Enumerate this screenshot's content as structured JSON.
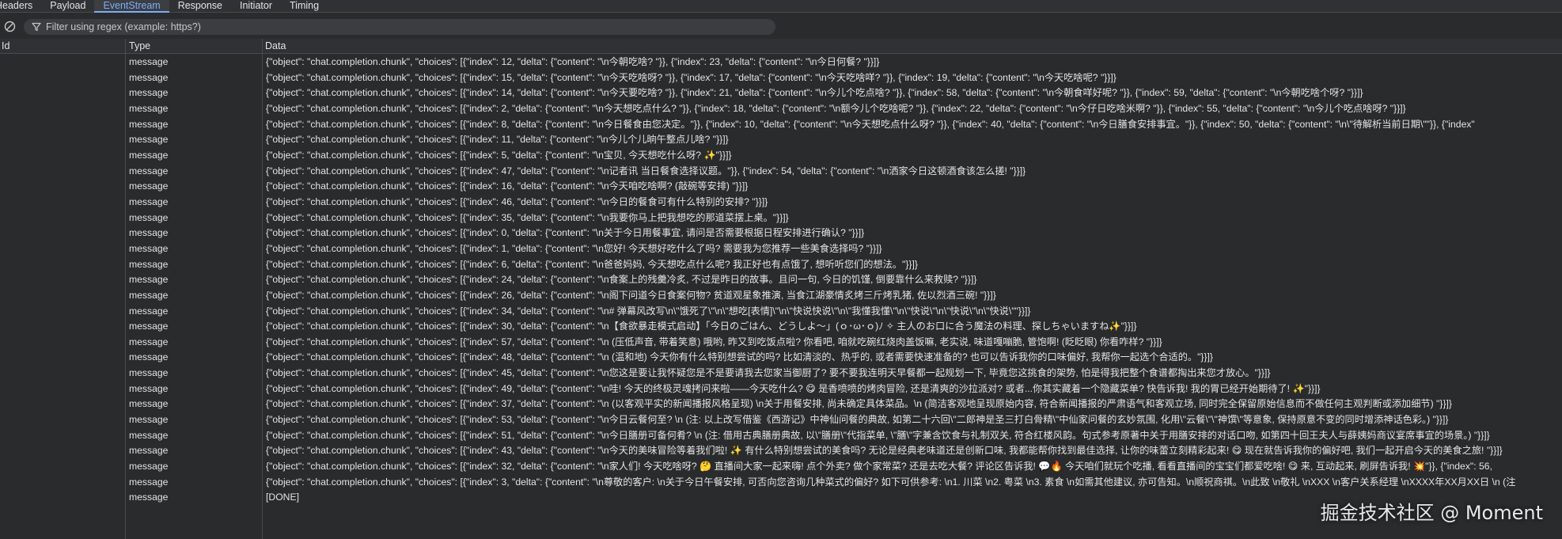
{
  "tabs": [
    {
      "label": "Headers",
      "active": false
    },
    {
      "label": "Payload",
      "active": false
    },
    {
      "label": "EventStream",
      "active": true
    },
    {
      "label": "Response",
      "active": false
    },
    {
      "label": "Initiator",
      "active": false
    },
    {
      "label": "Timing",
      "active": false
    }
  ],
  "filter": {
    "placeholder": "Filter using regex (example: https?)",
    "value": ""
  },
  "columns": {
    "id": "Id",
    "type": "Type",
    "data": "Data"
  },
  "icons": {
    "clear": "clear-icon",
    "filter": "filter-funnel-icon"
  },
  "colors": {
    "accent": "#7cacf8",
    "background": "#2a2b2d",
    "header": "#303134"
  },
  "rows": [
    {
      "id": "",
      "type": "message",
      "data": "{\"object\": \"chat.completion.chunk\", \"choices\": [{\"index\": 12, \"delta\": {\"content\": \"\\n今朝吃啥? \"}}, {\"index\": 23, \"delta\": {\"content\": \"\\n今日何餐? \"}}]}"
    },
    {
      "id": "",
      "type": "message",
      "data": "{\"object\": \"chat.completion.chunk\", \"choices\": [{\"index\": 15, \"delta\": {\"content\": \"\\n今天吃啥呀? \"}}, {\"index\": 17, \"delta\": {\"content\": \"\\n今天吃啥咩? \"}}, {\"index\": 19, \"delta\": {\"content\": \"\\n今天吃啥呢? \"}}]}"
    },
    {
      "id": "",
      "type": "message",
      "data": "{\"object\": \"chat.completion.chunk\", \"choices\": [{\"index\": 14, \"delta\": {\"content\": \"\\n今天要吃啥? \"}}, {\"index\": 21, \"delta\": {\"content\": \"\\n今儿个吃点啥? \"}}, {\"index\": 58, \"delta\": {\"content\": \"\\n今朝食咩好呢? \"}}, {\"index\": 59, \"delta\": {\"content\": \"\\n今朝吃啥个呀? \"}}]}"
    },
    {
      "id": "",
      "type": "message",
      "data": "{\"object\": \"chat.completion.chunk\", \"choices\": [{\"index\": 2, \"delta\": {\"content\": \"\\n今天想吃点什么? \"}}, {\"index\": 18, \"delta\": {\"content\": \"\\n额今儿个吃啥呢? \"}}, {\"index\": 22, \"delta\": {\"content\": \"\\n今仔日吃啥米啊? \"}}, {\"index\": 55, \"delta\": {\"content\": \"\\n今儿个吃点啥呀? \"}}]}"
    },
    {
      "id": "",
      "type": "message",
      "data": "{\"object\": \"chat.completion.chunk\", \"choices\": [{\"index\": 8, \"delta\": {\"content\": \"\\n今日餐食由您决定。\"}}, {\"index\": 10, \"delta\": {\"content\": \"\\n今天想吃点什么呀? \"}}, {\"index\": 40, \"delta\": {\"content\": \"\\n今日膳食安排事宜。\"}}, {\"index\": 50, \"delta\": {\"content\": \"\\n\\\"待解析当前日期\\\"\"}}, {\"index\""
    },
    {
      "id": "",
      "type": "message",
      "data": "{\"object\": \"chat.completion.chunk\", \"choices\": [{\"index\": 11, \"delta\": {\"content\": \"\\n今儿个儿晌午整点儿啥? \"}}]}"
    },
    {
      "id": "",
      "type": "message",
      "data": "{\"object\": \"chat.completion.chunk\", \"choices\": [{\"index\": 5, \"delta\": {\"content\": \"\\n宝贝, 今天想吃什么呀? ✨\"}}]}"
    },
    {
      "id": "",
      "type": "message",
      "data": "{\"object\": \"chat.completion.chunk\", \"choices\": [{\"index\": 47, \"delta\": {\"content\": \"\\n记者讯 当日餐食选择议题。\"}}, {\"index\": 54, \"delta\": {\"content\": \"\\n洒家今日这顿酒食该怎么搓! \"}}]}"
    },
    {
      "id": "",
      "type": "message",
      "data": "{\"object\": \"chat.completion.chunk\", \"choices\": [{\"index\": 16, \"delta\": {\"content\": \"\\n今天咱吃啥啊? (敲碗等安排) \"}}]}"
    },
    {
      "id": "",
      "type": "message",
      "data": "{\"object\": \"chat.completion.chunk\", \"choices\": [{\"index\": 46, \"delta\": {\"content\": \"\\n今日的餐食可有什么特别的安排? \"}}]}"
    },
    {
      "id": "",
      "type": "message",
      "data": "{\"object\": \"chat.completion.chunk\", \"choices\": [{\"index\": 35, \"delta\": {\"content\": \"\\n我要你马上把我想吃的那道菜摆上桌。\"}}]}"
    },
    {
      "id": "",
      "type": "message",
      "data": "{\"object\": \"chat.completion.chunk\", \"choices\": [{\"index\": 0, \"delta\": {\"content\": \"\\n关于今日用餐事宜, 请问是否需要根据日程安排进行确认? \"}}]}"
    },
    {
      "id": "",
      "type": "message",
      "data": "{\"object\": \"chat.completion.chunk\", \"choices\": [{\"index\": 1, \"delta\": {\"content\": \"\\n您好! 今天想好吃什么了吗? 需要我为您推荐一些美食选择吗? \"}}]}"
    },
    {
      "id": "",
      "type": "message",
      "data": "{\"object\": \"chat.completion.chunk\", \"choices\": [{\"index\": 6, \"delta\": {\"content\": \"\\n爸爸妈妈, 今天想吃点什么呢? 我正好也有点饿了, 想听听您们的想法。\"}}]}"
    },
    {
      "id": "",
      "type": "message",
      "data": "{\"object\": \"chat.completion.chunk\", \"choices\": [{\"index\": 24, \"delta\": {\"content\": \"\\n食案上的残羹冷炙, 不过是昨日的故事。且问一句, 今日的饥馑, 倒要靠什么来救赎? \"}}]}"
    },
    {
      "id": "",
      "type": "message",
      "data": "{\"object\": \"chat.completion.chunk\", \"choices\": [{\"index\": 26, \"delta\": {\"content\": \"\\n阁下问道今日食案何物? 贫道观星象推演, 当食江湖豪情炙烤三斤烤乳猪, 佐以烈酒三碗! \"}}]}"
    },
    {
      "id": "",
      "type": "message",
      "data": "{\"object\": \"chat.completion.chunk\", \"choices\": [{\"index\": 34, \"delta\": {\"content\": \"\\n# 弹幕风改写\\n\\\"饿死了\\\"\\n\\\"想吃[表情]\\\"\\n\\\"快说快说\\\"\\n\\\"我懂我懂\\\"\\n\\\"快说\\\"\\n\\\"快说\\\"\\n\\\"快说\\\"\"}}]}"
    },
    {
      "id": "",
      "type": "message",
      "data": "{\"object\": \"chat.completion.chunk\", \"choices\": [{\"index\": 30, \"delta\": {\"content\": \"\\n【食欲暴走模式启动】「今日のごはん、どうしよ〜」(ｏ･ω･ｏ)ﾉ ✧ 主人のお口に合う魔法の料理、探しちゃいますね✨\"}}]}"
    },
    {
      "id": "",
      "type": "message",
      "data": "{\"object\": \"chat.completion.chunk\", \"choices\": [{\"index\": 57, \"delta\": {\"content\": \"\\n (压低声音, 带着笑意) 哦哟, 昨又到吃饭点啦? 你看吧, 咱就吃碗红烧肉盖饭嘛, 老实说, 味道嘎嘣脆, 管饱啊! (眨眨眼) 你看咋样? \"}}]}"
    },
    {
      "id": "",
      "type": "message",
      "data": "{\"object\": \"chat.completion.chunk\", \"choices\": [{\"index\": 48, \"delta\": {\"content\": \"\\n (温和地) 今天你有什么特别想尝试的吗? 比如清淡的、热乎的, 或者需要快速准备的? 也可以告诉我你的口味偏好, 我帮你一起选个合适的。\"}}]}"
    },
    {
      "id": "",
      "type": "message",
      "data": "{\"object\": \"chat.completion.chunk\", \"choices\": [{\"index\": 45, \"delta\": {\"content\": \"\\n您这是要让我怀疑您是不是要请我去您家当御厨了? 要不要我连明天早餐都一起规划一下, 毕竟您这挑食的架势, 怕是得我把整个食谱都掏出来您才放心。\"}}]}"
    },
    {
      "id": "",
      "type": "message",
      "data": "{\"object\": \"chat.completion.chunk\", \"choices\": [{\"index\": 49, \"delta\": {\"content\": \"\\n哇! 今天的终极灵魂拷问来啦——今天吃什么? 😋 是香喷喷的烤肉冒险, 还是清爽的沙拉派对? 或者...你其实藏着一个隐藏菜单? 快告诉我! 我的胃已经开始期待了! ✨\"}}]}"
    },
    {
      "id": "",
      "type": "message",
      "data": "{\"object\": \"chat.completion.chunk\", \"choices\": [{\"index\": 37, \"delta\": {\"content\": \"\\n (以客观平实的新闻播报风格呈现) \\n关于用餐安排, 尚未确定具体菜品。\\n (简洁客观地呈现原始内容, 符合新闻播报的严肃语气和客观立场, 同时完全保留原始信息而不做任何主观判断或添加细节) \"}}]}"
    },
    {
      "id": "",
      "type": "message",
      "data": "{\"object\": \"chat.completion.chunk\", \"choices\": [{\"index\": 53, \"delta\": {\"content\": \"\\n今日云餐何至? \\n (注: 以上改写借鉴《西游记》中神仙问餐的典故, 如第二十六回\\\"二郎神是圣三打白骨精\\\"中仙家问餐的玄妙氛围, 化用\\\"云餐\\\"\\\"神馔\\\"等意象, 保持原意不变的同时增添神话色彩。) \"}}]}"
    },
    {
      "id": "",
      "type": "message",
      "data": "{\"object\": \"chat.completion.chunk\", \"choices\": [{\"index\": 51, \"delta\": {\"content\": \"\\n今日膳册可备何肴? \\n (注: 借用古典膳册典故, 以\\\"膳册\\\"代指菜单, \\\"膳\\\"字兼含饮食与礼制双关, 符合红楼风韵。句式参考原著中关于用膳安排的对话口吻, 如第四十回王夫人与薛姨妈商议宴席事宜的场景。) \"}}]}"
    },
    {
      "id": "",
      "type": "message",
      "data": "{\"object\": \"chat.completion.chunk\", \"choices\": [{\"index\": 43, \"delta\": {\"content\": \"\\n今天的美味冒险等着我们啦! ✨ 有什么特别想尝试的美食吗? 无论是经典老味道还是创新口味, 我都能帮你找到最佳选择, 让你的味蕾立刻精彩起来! 😋 现在就告诉我你的偏好吧, 我们一起开启今天的美食之旅! \"}}]}"
    },
    {
      "id": "",
      "type": "message",
      "data": "{\"object\": \"chat.completion.chunk\", \"choices\": [{\"index\": 32, \"delta\": {\"content\": \"\\n家人们! 今天吃啥呀? 🤔 直播间大家一起来嗨! 点个外卖? 做个家常菜? 还是去吃大餐? 评论区告诉我! 💬🔥 今天咱们就玩个吃播, 看看直播间的宝宝们都爱吃啥! 😋 来, 互动起来, 刷屏告诉我! 💥\"}}, {\"index\": 56,"
    },
    {
      "id": "",
      "type": "message",
      "data": "{\"object\": \"chat.completion.chunk\", \"choices\": [{\"index\": 3, \"delta\": {\"content\": \"\\n尊敬的客户: \\n关于今日午餐安排, 可否向您咨询几种菜式的偏好? 如下可供参考: \\n1. 川菜 \\n2. 粤菜 \\n3. 素食 \\n如需其他建议, 亦可告知。\\n顺祝商祺。\\n此致 \\n敬礼 \\nXXX \\n客户关系经理 \\nXXXX年XX月XX日 \\n (注"
    },
    {
      "id": "",
      "type": "message",
      "data": "[DONE]"
    }
  ],
  "watermark": "掘金技术社区 @ Moment"
}
